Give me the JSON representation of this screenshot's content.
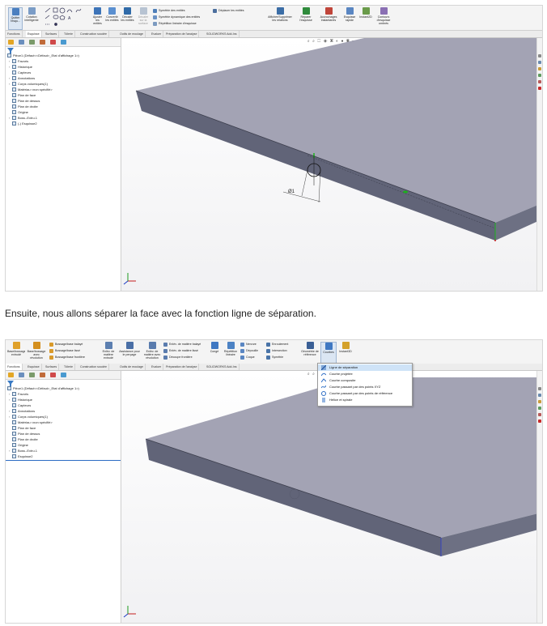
{
  "caption": "Ensuite, nous allons séparer la face avec la fonction ligne de séparation.",
  "colors": {
    "part_top": "#a3a3b4",
    "part_side": "#616478",
    "sketch_green": "#1bb31b",
    "ribbon_bg": "#f4f4f4",
    "highlight": "#cfe3f7"
  },
  "shot1": {
    "ribbon_buttons": [
      "Quitter l'esqu...",
      "Cotation intelligente",
      "Ajuster les entités",
      "Convertir les entités",
      "Décaler les entités",
      "Décaler sur la surface",
      "Afficher/Supprimer les relations",
      "Réparer l'esquisse",
      "Accrochages instantanés",
      "Esquisse rapide",
      "Instant2D",
      "Contours d'esquisse ombrés"
    ],
    "ribbon_small": [
      "Symétrie des entités",
      "Symétrie dynamique des entités",
      "Répétition linéaire d'esquisse",
      "Déplacer les entités"
    ],
    "tabs": [
      "Fonctions",
      "Esquisse",
      "Surfaces",
      "Tôlerie",
      "Construction soudée",
      "Outils de moulage",
      "Evaluer",
      "Préparation de l'analyse",
      "SOLIDWORKS Add-Ins"
    ],
    "active_tab": 1,
    "tree": {
      "root": "Pièce1 (Défaut<<Défaut>_Etat d'affichage 1>)",
      "items": [
        "Favoris",
        "Historique",
        "Capteurs",
        "Annotations",
        "Corps volumiques(1)",
        "Matériau <non spécifié>",
        "Plan de face",
        "Plan de dessus",
        "Plan de droite",
        "Origine",
        "Boss.-Extru.1",
        "(-) Esquisse2"
      ]
    },
    "dimension_label": "Ø1"
  },
  "shot2": {
    "ribbon_buttons": [
      "Base/bossage extrudé",
      "Base/bossage avec révolution",
      "Enlèv. de matière extrudé",
      "Assistance pour le perçage",
      "Enlèv. de matière avec révolution",
      "Congé",
      "Répétition linéaire",
      "Coque",
      "Géométrie de référence",
      "Courbes",
      "Instant3D"
    ],
    "ribbon_small": [
      "Bossage/base balayé",
      "Bossage/base lissé",
      "Bossage/base frontière",
      "Enlèv. de matière balayé",
      "Enlèv. de matière lissé",
      "Découpe frontière",
      "Nervure",
      "Dépouille",
      "Coque",
      "Enroulement",
      "Intersection",
      "Symétrie"
    ],
    "tabs": [
      "Fonctions",
      "Esquisse",
      "Surfaces",
      "Tôlerie",
      "Construction soudée",
      "Outils de moulage",
      "Evaluer",
      "Préparation de l'analyse",
      "SOLIDWORKS Add-Ins"
    ],
    "active_tab": 0,
    "tree": {
      "root": "Pièce1 (Défaut<<Défaut>_Etat d'affichage 1>)",
      "items": [
        "Favoris",
        "Historique",
        "Capteurs",
        "Annotations",
        "Corps volumiques(1)",
        "Matériau <non spécifié>",
        "Plan de face",
        "Plan de dessus",
        "Plan de droite",
        "Origine",
        "Boss.-Extru.1",
        "Esquisse2"
      ]
    },
    "dropdown": [
      "Ligne de séparation",
      "Courbe projetée",
      "Courbe composite",
      "Courbe passant par des points XYZ",
      "Courbe passant par des points de référence",
      "Hélice et spirale"
    ],
    "dropdown_highlight": 0
  }
}
